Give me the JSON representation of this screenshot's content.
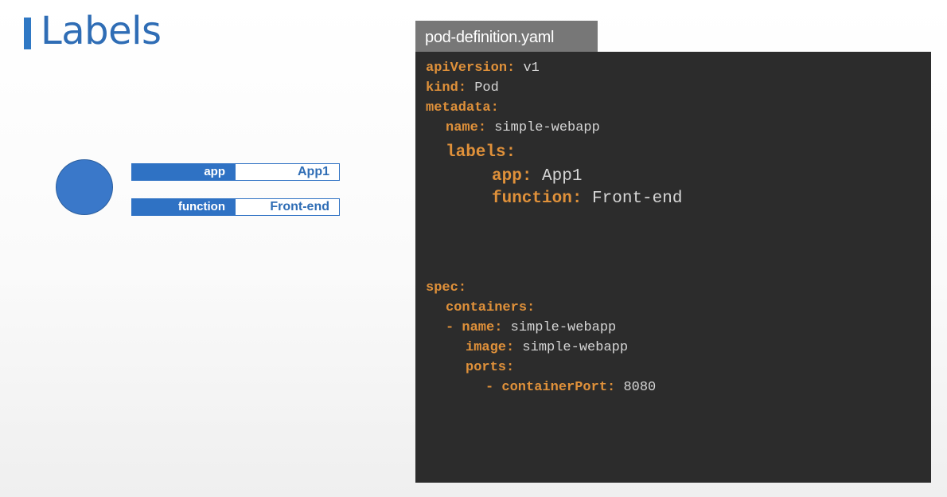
{
  "slide": {
    "title": "Labels"
  },
  "pod": {
    "labels": [
      {
        "key": "app",
        "value": "App1"
      },
      {
        "key": "function",
        "value": "Front-end"
      }
    ]
  },
  "file": {
    "name": "pod-definition.yaml"
  },
  "yaml": {
    "api_version_key": "apiVersion",
    "api_version_value": "v1",
    "kind_key": "kind",
    "kind_value": "Pod",
    "metadata_key": "metadata",
    "name_key": "name",
    "name_value": "simple-webapp",
    "labels_key": "labels",
    "app_key": "app",
    "app_value": "App1",
    "function_key": "function",
    "function_value": "Front-end",
    "spec_key": "spec",
    "containers_key": "containers",
    "container_name_key": "name",
    "container_name_value": "simple-webapp",
    "image_key": "image",
    "image_value": "simple-webapp",
    "ports_key": "ports",
    "container_port_key": "containerPort",
    "container_port_value": "8080"
  },
  "colors": {
    "accent_blue": "#2f72c4",
    "yaml_key": "#e0913a",
    "yaml_value": "#d6d6d6",
    "code_bg": "#2c2c2c",
    "tab_bg": "#777777"
  }
}
